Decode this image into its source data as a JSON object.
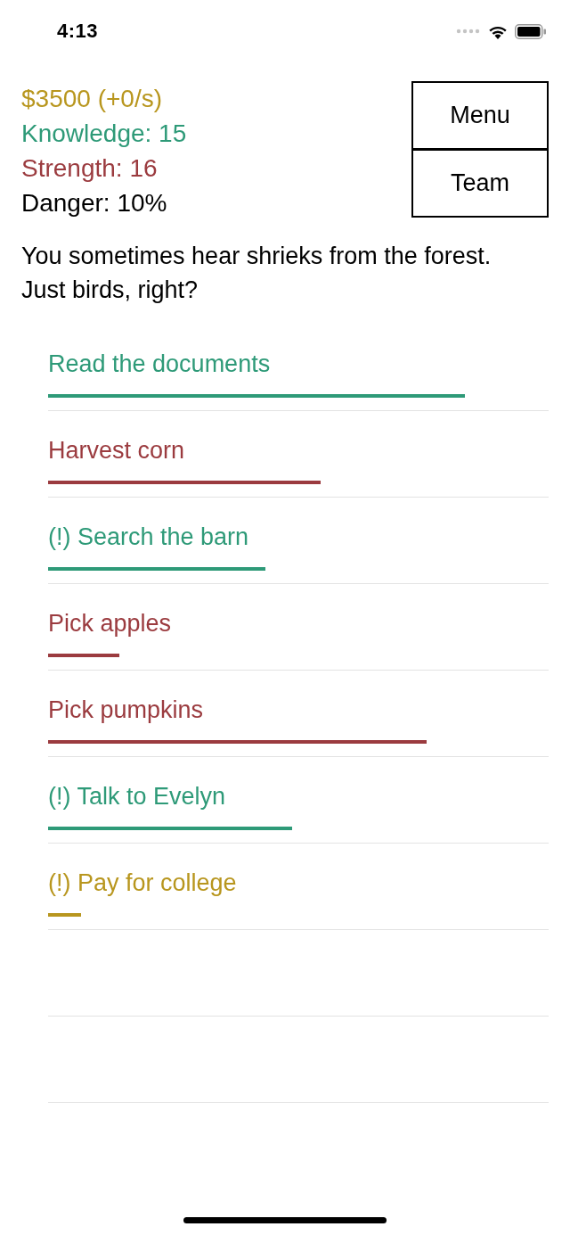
{
  "status_bar": {
    "time": "4:13"
  },
  "stats": [
    {
      "text": "$3500 (+0/s)",
      "color": "#b8961e"
    },
    {
      "text": "Knowledge: 15",
      "color": "#2e9a78"
    },
    {
      "text": "Strength: 16",
      "color": "#9b3b3f"
    },
    {
      "text": "Danger: 10%",
      "color": "#000000"
    }
  ],
  "buttons": [
    "Menu",
    "Team"
  ],
  "message": "You sometimes hear shrieks from the forest. Just birds, right?",
  "tasks": [
    {
      "kind": "task",
      "label": "Read the documents",
      "color": "#2e9a78",
      "level": 0.833
    },
    {
      "kind": "task",
      "label": "Harvest corn",
      "color": "#9b3b3f",
      "level": 0.544
    },
    {
      "kind": "task",
      "label": "(!) Search the barn",
      "color": "#2e9a78",
      "level": 0.434
    },
    {
      "kind": "task",
      "label": "Pick apples",
      "color": "#9b3b3f",
      "level": 0.142
    },
    {
      "kind": "task",
      "label": "Pick pumpkins",
      "color": "#9b3b3f",
      "level": 0.756
    },
    {
      "kind": "task",
      "label": "(!) Talk to Evelyn",
      "color": "#2e9a78",
      "level": 0.488
    },
    {
      "kind": "task",
      "label": "(!) Pay for college",
      "color": "#b8961e",
      "level": 0.066
    },
    {
      "kind": "empty"
    },
    {
      "kind": "empty"
    }
  ]
}
